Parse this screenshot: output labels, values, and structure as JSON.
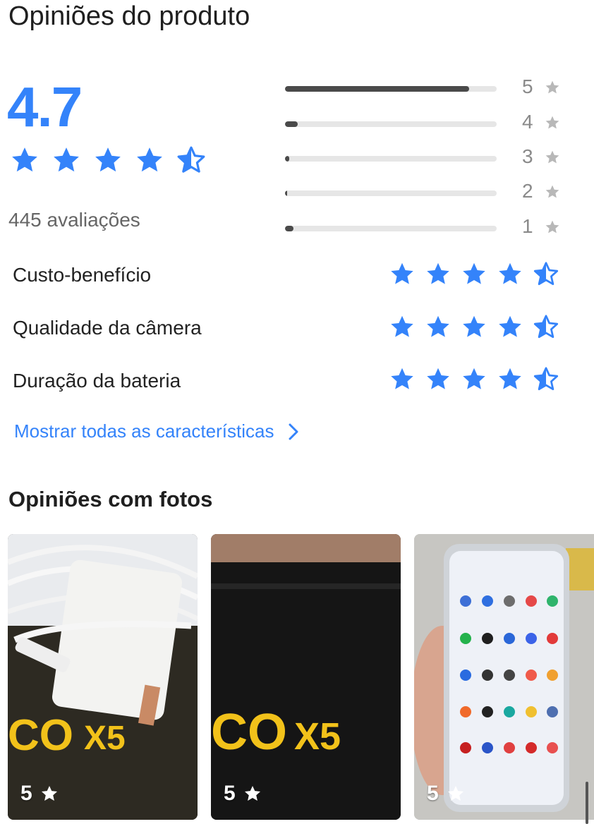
{
  "page_title": "Opiniões do produto",
  "rating": {
    "average": "4.7",
    "average_value": 4.7,
    "review_count": "445 avaliações"
  },
  "distribution": [
    {
      "label": "5",
      "fraction": 0.87
    },
    {
      "label": "4",
      "fraction": 0.06
    },
    {
      "label": "3",
      "fraction": 0.02
    },
    {
      "label": "2",
      "fraction": 0.01
    },
    {
      "label": "1",
      "fraction": 0.04
    }
  ],
  "attributes": [
    {
      "label": "Custo-benefício",
      "stars": 4.5
    },
    {
      "label": "Qualidade da câmera",
      "stars": 4.5
    },
    {
      "label": "Duração da bateria",
      "stars": 4.5
    }
  ],
  "show_all_link": "Mostrar todas as características",
  "photos_title": "Opiniões com fotos",
  "photos": [
    {
      "rating": "5",
      "brand_text_1": "CO",
      "brand_text_2": "X5"
    },
    {
      "rating": "5",
      "brand_text_1": "CO",
      "brand_text_2": "X5"
    },
    {
      "rating": "5"
    }
  ],
  "colors": {
    "accent": "#3483fa",
    "bar_fill": "#4a4a4a",
    "bar_track": "#e6e6e6",
    "gray_star": "#b8b8b8"
  },
  "icons": {
    "rating_star": "star-icon",
    "half_star": "half-star-icon",
    "chevron": "chevron-right-icon"
  }
}
